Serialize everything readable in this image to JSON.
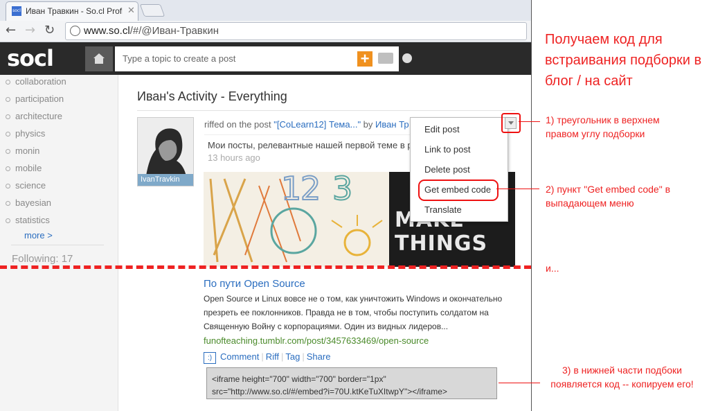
{
  "browser": {
    "tab_favicon": "socl",
    "tab_title": "Иван Травкин - So.cl Profi",
    "tab_close": "✕",
    "url_host": "www.so.cl",
    "url_path": "/#/@Иван-Травкин"
  },
  "header": {
    "logo": "socl",
    "post_placeholder": "Type a topic to create a post",
    "plus_label": "+"
  },
  "sidebar": {
    "items": [
      "collaboration",
      "participation",
      "architecture",
      "physics",
      "monin",
      "mobile",
      "science",
      "bayesian",
      "statistics"
    ],
    "more": "more >",
    "following": "Following: 17"
  },
  "main": {
    "title": "Иван's Activity - Everything",
    "avatar_name": "IvanTravkin",
    "riffed_prefix": "riffed on the post ",
    "riffed_post": "\"[CoLearn12] Тема...\"",
    "riffed_by": " by ",
    "riffed_author": "Иван Тр",
    "comment": "Мои посты, релевантные нашей первой теме в р",
    "time": "13 hours ago",
    "image_text": [
      "MAKE",
      "THINGS"
    ],
    "post_title": "По пути Open Source",
    "post_body": "Open Source и Linux вовсе не о том, как уничтожить Windows и окончательно презреть ее поклонников. Правда не в том, чтобы поступить солдатом на Священную Войну с корпорациями. Один из видных лидеров...",
    "post_url": "funofteaching.tumblr.com/post/3457633469/open-source",
    "smiley": ":)",
    "actions": [
      "Comment",
      "Riff",
      "Tag",
      "Share"
    ],
    "embed_code": "<iframe height=\"700\" width=\"700\" border=\"1px\" src=\"http://www.so.cl/#/embed?i=70U.ktKeTuXItwpY\"></iframe>"
  },
  "menu": {
    "items": [
      "Edit post",
      "Link to post",
      "Delete post",
      "Get embed code",
      "Translate"
    ]
  },
  "notes": {
    "heading": "Получаем код для встраивания подборки в блог / на сайт",
    "step1": "1) треугольник в верхнем правом углу подборки",
    "step2": "2) пункт \"Get embed code\" в выпадающем меню",
    "and": "и...",
    "step3": "3) в нижней части подбоки появляется код -- копируем его!"
  },
  "colors": {
    "annotation": "#e22222",
    "link": "#2a6dbf",
    "accent": "#f0911f"
  }
}
